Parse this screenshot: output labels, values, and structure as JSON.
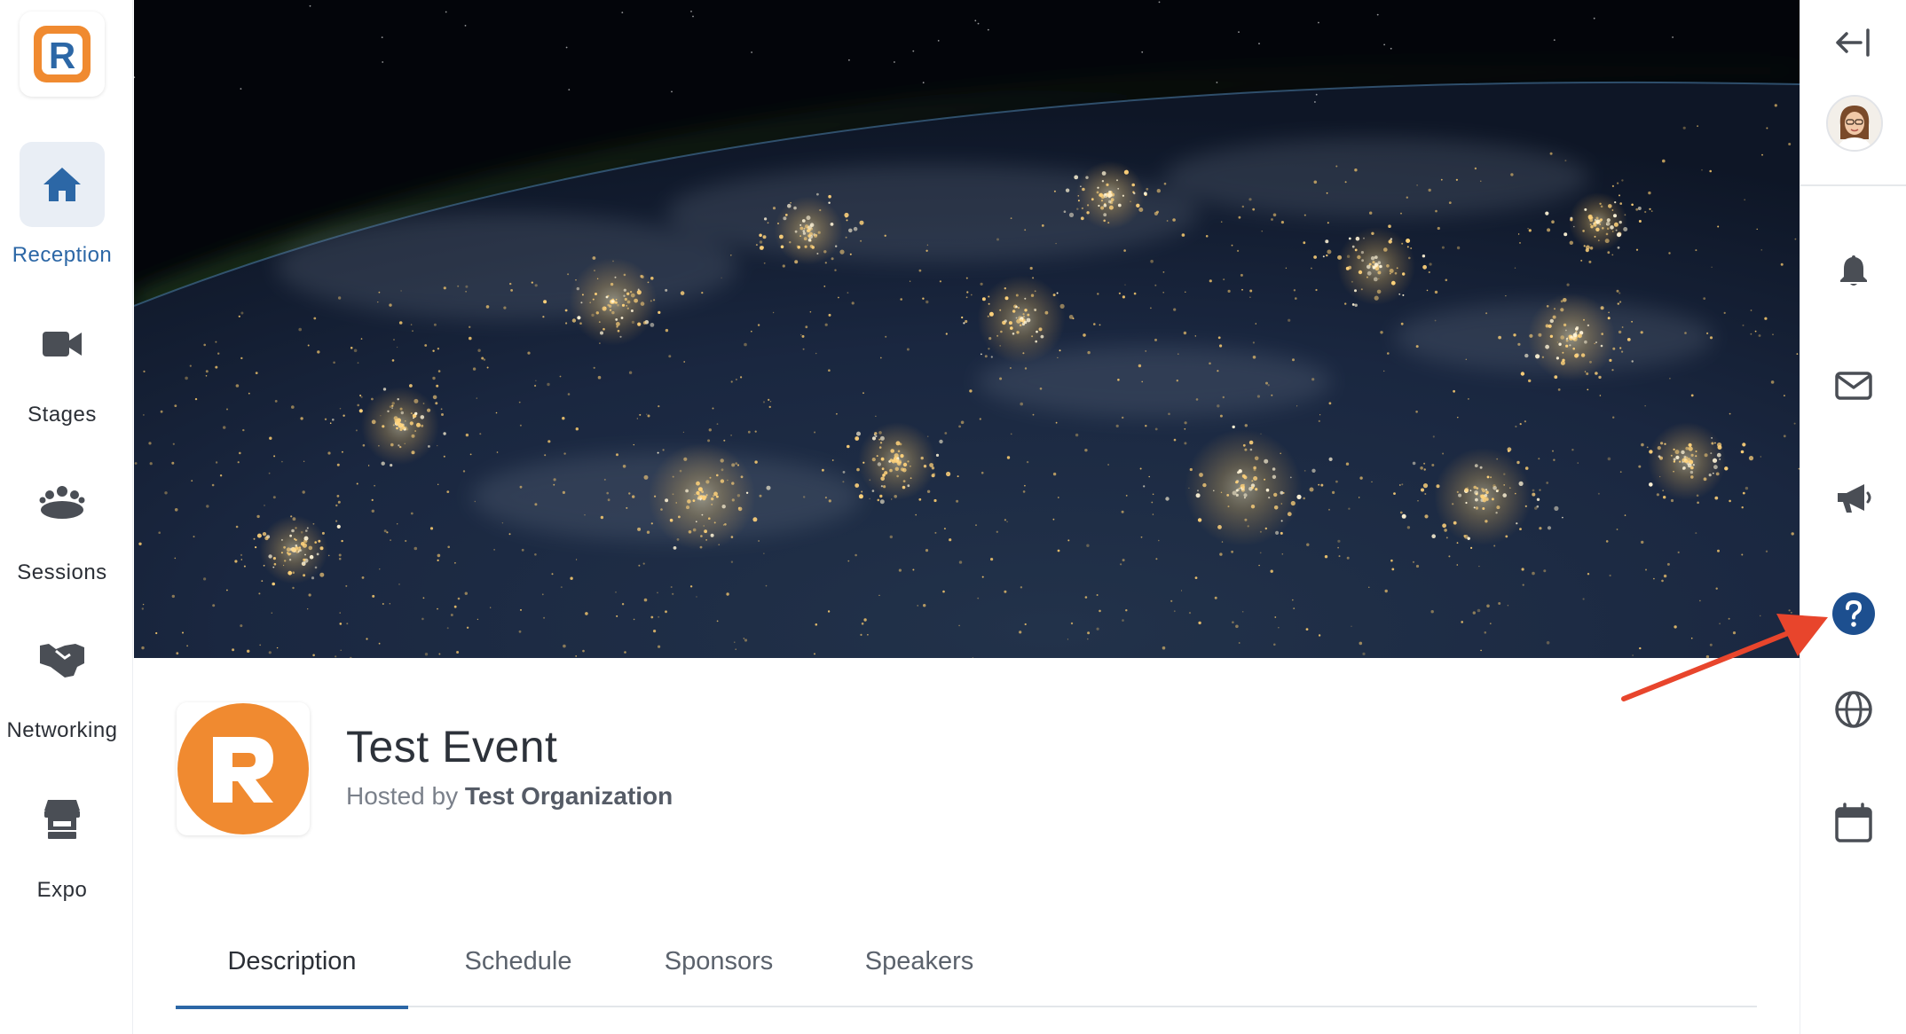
{
  "app": {
    "brand_letter": "R",
    "accent_color": "#2c67a6",
    "brand_orange": "#f08a30"
  },
  "sidebar": {
    "items": [
      {
        "label": "Reception",
        "icon": "home-icon",
        "active": true
      },
      {
        "label": "Stages",
        "icon": "video-camera-icon",
        "active": false
      },
      {
        "label": "Sessions",
        "icon": "group-icon",
        "active": false
      },
      {
        "label": "Networking",
        "icon": "handshake-icon",
        "active": false
      },
      {
        "label": "Expo",
        "icon": "booth-icon",
        "active": false
      }
    ]
  },
  "hero": {
    "image": "earth-at-night-from-space"
  },
  "event": {
    "title": "Test Event",
    "hosted_prefix": "Hosted by",
    "organization": "Test Organization"
  },
  "tabs": [
    {
      "label": "Description",
      "active": true
    },
    {
      "label": "Schedule",
      "active": false
    },
    {
      "label": "Sponsors",
      "active": false
    },
    {
      "label": "Speakers",
      "active": false
    }
  ],
  "right_sidebar": {
    "buttons": [
      {
        "icon": "collapse-left-icon"
      },
      {
        "icon": "avatar"
      },
      {
        "icon": "bell-icon"
      },
      {
        "icon": "envelope-icon"
      },
      {
        "icon": "megaphone-icon"
      },
      {
        "icon": "help-icon",
        "color": "#1d4f8f"
      },
      {
        "icon": "globe-icon"
      },
      {
        "icon": "calendar-icon"
      }
    ]
  },
  "annotation": {
    "arrow_color": "#e8452c",
    "points_to": "help-icon"
  }
}
